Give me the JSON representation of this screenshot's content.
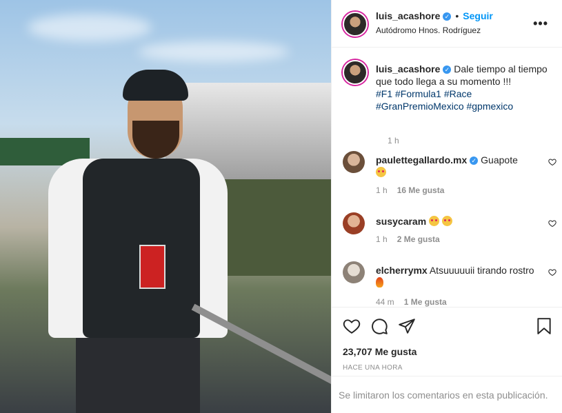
{
  "post": {
    "username": "luis_acashore",
    "follow_label": "Seguir",
    "separator": "•",
    "location": "Autódromo Hnos. Rodríguez",
    "more_label": "•••"
  },
  "caption": {
    "username": "luis_acashore",
    "text": "Dale tiempo al tiempo que todo llega a su momento !!!",
    "hashtags_line1": "#F1 #Formula1 #Race",
    "hashtags_line2": "#GranPremioMexico #gpmexico",
    "time": "1 h"
  },
  "comments": [
    {
      "username": "paulettegallardo.mx",
      "text": "Guapote",
      "time": "1 h",
      "likes": "16 Me gusta",
      "avatar_color": "#8a6d55"
    },
    {
      "username": "susycaram",
      "text": "",
      "time": "1 h",
      "likes": "2 Me gusta",
      "avatar_color": "#a0462e"
    },
    {
      "username": "elcherrymx",
      "text": "Atsuuuuuii tirando rostro",
      "time": "44 m",
      "likes": "1 Me gusta",
      "avatar_color": "#b9b0a6"
    }
  ],
  "icons": {
    "like": "heart-icon",
    "comment": "comment-icon",
    "share": "share-icon",
    "save": "bookmark-icon",
    "verified": "verified-badge-icon"
  },
  "stats": {
    "likes": "23,707 Me gusta",
    "time_ago": "HACE UNA HORA"
  },
  "footer": {
    "limited_comments": "Se limitaron los comentarios en esta publicación."
  },
  "colors": {
    "link_blue": "#0095f6",
    "hashtag": "#00376b",
    "muted": "#8e8e8e",
    "verified": "#3897f0"
  }
}
